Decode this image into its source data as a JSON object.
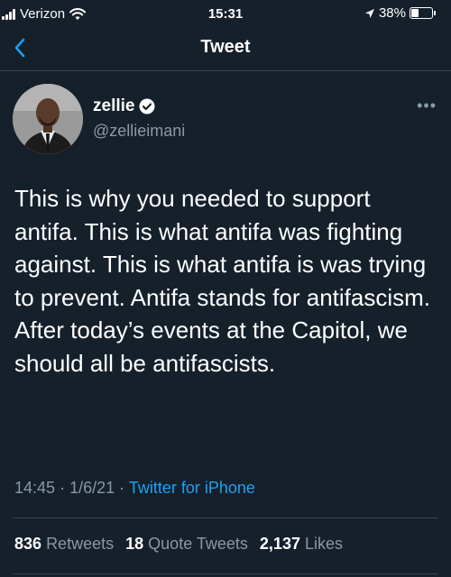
{
  "status_bar": {
    "carrier": "Verizon",
    "time": "15:31",
    "battery": "38%",
    "battery_level": 0.38
  },
  "nav": {
    "title": "Tweet"
  },
  "author": {
    "display_name": "zellie",
    "handle": "@zellieimani",
    "verified": true
  },
  "tweet": {
    "text": "This is why you needed to support antifa. This is what antifa was fighting against. This is what antifa is was trying to prevent. Antifa stands for antifascism. After today’s events at the Capitol, we should all be antifascists.",
    "time": "14:45",
    "date": "1/6/21",
    "separator": "·",
    "source": "Twitter for iPhone"
  },
  "stats": {
    "retweets_count": "836",
    "retweets_label": "Retweets",
    "quotes_count": "18",
    "quotes_label": "Quote Tweets",
    "likes_count": "2,137",
    "likes_label": "Likes"
  },
  "colors": {
    "background": "#15202b",
    "accent": "#1da1f2",
    "secondary_text": "#8899a6"
  }
}
